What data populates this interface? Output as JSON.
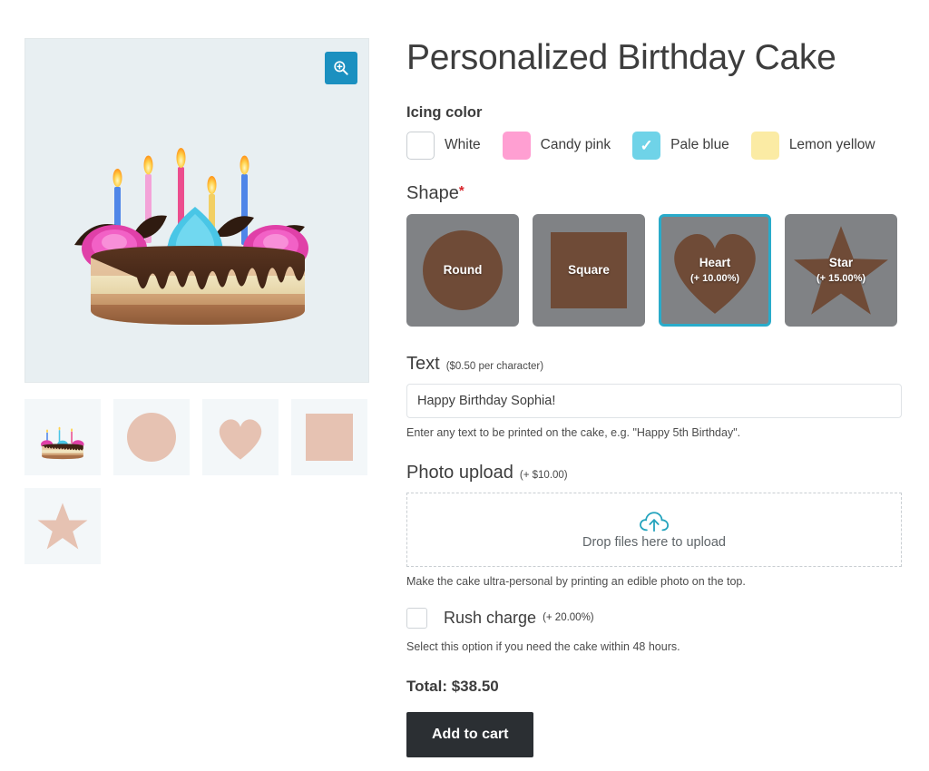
{
  "product": {
    "title": "Personalized Birthday Cake",
    "main_image_alt": "birthday-cake-photo",
    "zoom_icon": "magnifier-plus-icon"
  },
  "thumbnails": [
    {
      "name": "cake-photo",
      "shape": "photo"
    },
    {
      "name": "round-shape",
      "shape": "circle"
    },
    {
      "name": "heart-shape",
      "shape": "heart"
    },
    {
      "name": "square-shape",
      "shape": "square"
    },
    {
      "name": "star-shape",
      "shape": "star"
    }
  ],
  "icing": {
    "label": "Icing color",
    "options": [
      {
        "label": "White",
        "color": "#ffffff",
        "selected": false,
        "outline": true
      },
      {
        "label": "Candy pink",
        "color": "#ff9fd2",
        "selected": false,
        "outline": false
      },
      {
        "label": "Pale blue",
        "color": "#6fd3e8",
        "selected": true,
        "outline": false
      },
      {
        "label": "Lemon yellow",
        "color": "#fbeba4",
        "selected": false,
        "outline": false
      }
    ],
    "check_glyph": "✓"
  },
  "shape": {
    "label": "Shape",
    "required_marker": "*",
    "tile_bg": "#808285",
    "art_color": "#6f4b37",
    "selected_border": "#29abca",
    "options": [
      {
        "name": "Round",
        "price": "",
        "form": "circle",
        "selected": false
      },
      {
        "name": "Square",
        "price": "",
        "form": "square",
        "selected": false
      },
      {
        "name": "Heart",
        "price": "(+ 10.00%)",
        "form": "heart",
        "selected": true
      },
      {
        "name": "Star",
        "price": "(+ 15.00%)",
        "form": "star",
        "selected": false
      }
    ]
  },
  "text_field": {
    "label": "Text",
    "price_note": "($0.50 per character)",
    "value": "Happy Birthday Sophia!",
    "placeholder": "",
    "helper": "Enter any text to be printed on the cake, e.g. \"Happy 5th Birthday\"."
  },
  "photo_upload": {
    "label": "Photo upload",
    "price_note": "(+ $10.00)",
    "drop_text": "Drop files here to upload",
    "icon": "cloud-upload-icon",
    "helper": "Make the cake ultra-personal by printing an edible photo on the top."
  },
  "rush": {
    "label": "Rush charge",
    "price_note": "(+ 20.00%)",
    "checked": false,
    "helper": "Select this option if you need the cake within 48 hours."
  },
  "totals": {
    "total_text": "Total: $38.50",
    "add_to_cart": "Add to cart"
  },
  "colors": {
    "accent_blue": "#1b90c0",
    "selected_cyan": "#29abca",
    "dark_button": "#2b2f33",
    "image_bg": "#e8eff2",
    "thumb_bg": "#f3f7f9"
  }
}
